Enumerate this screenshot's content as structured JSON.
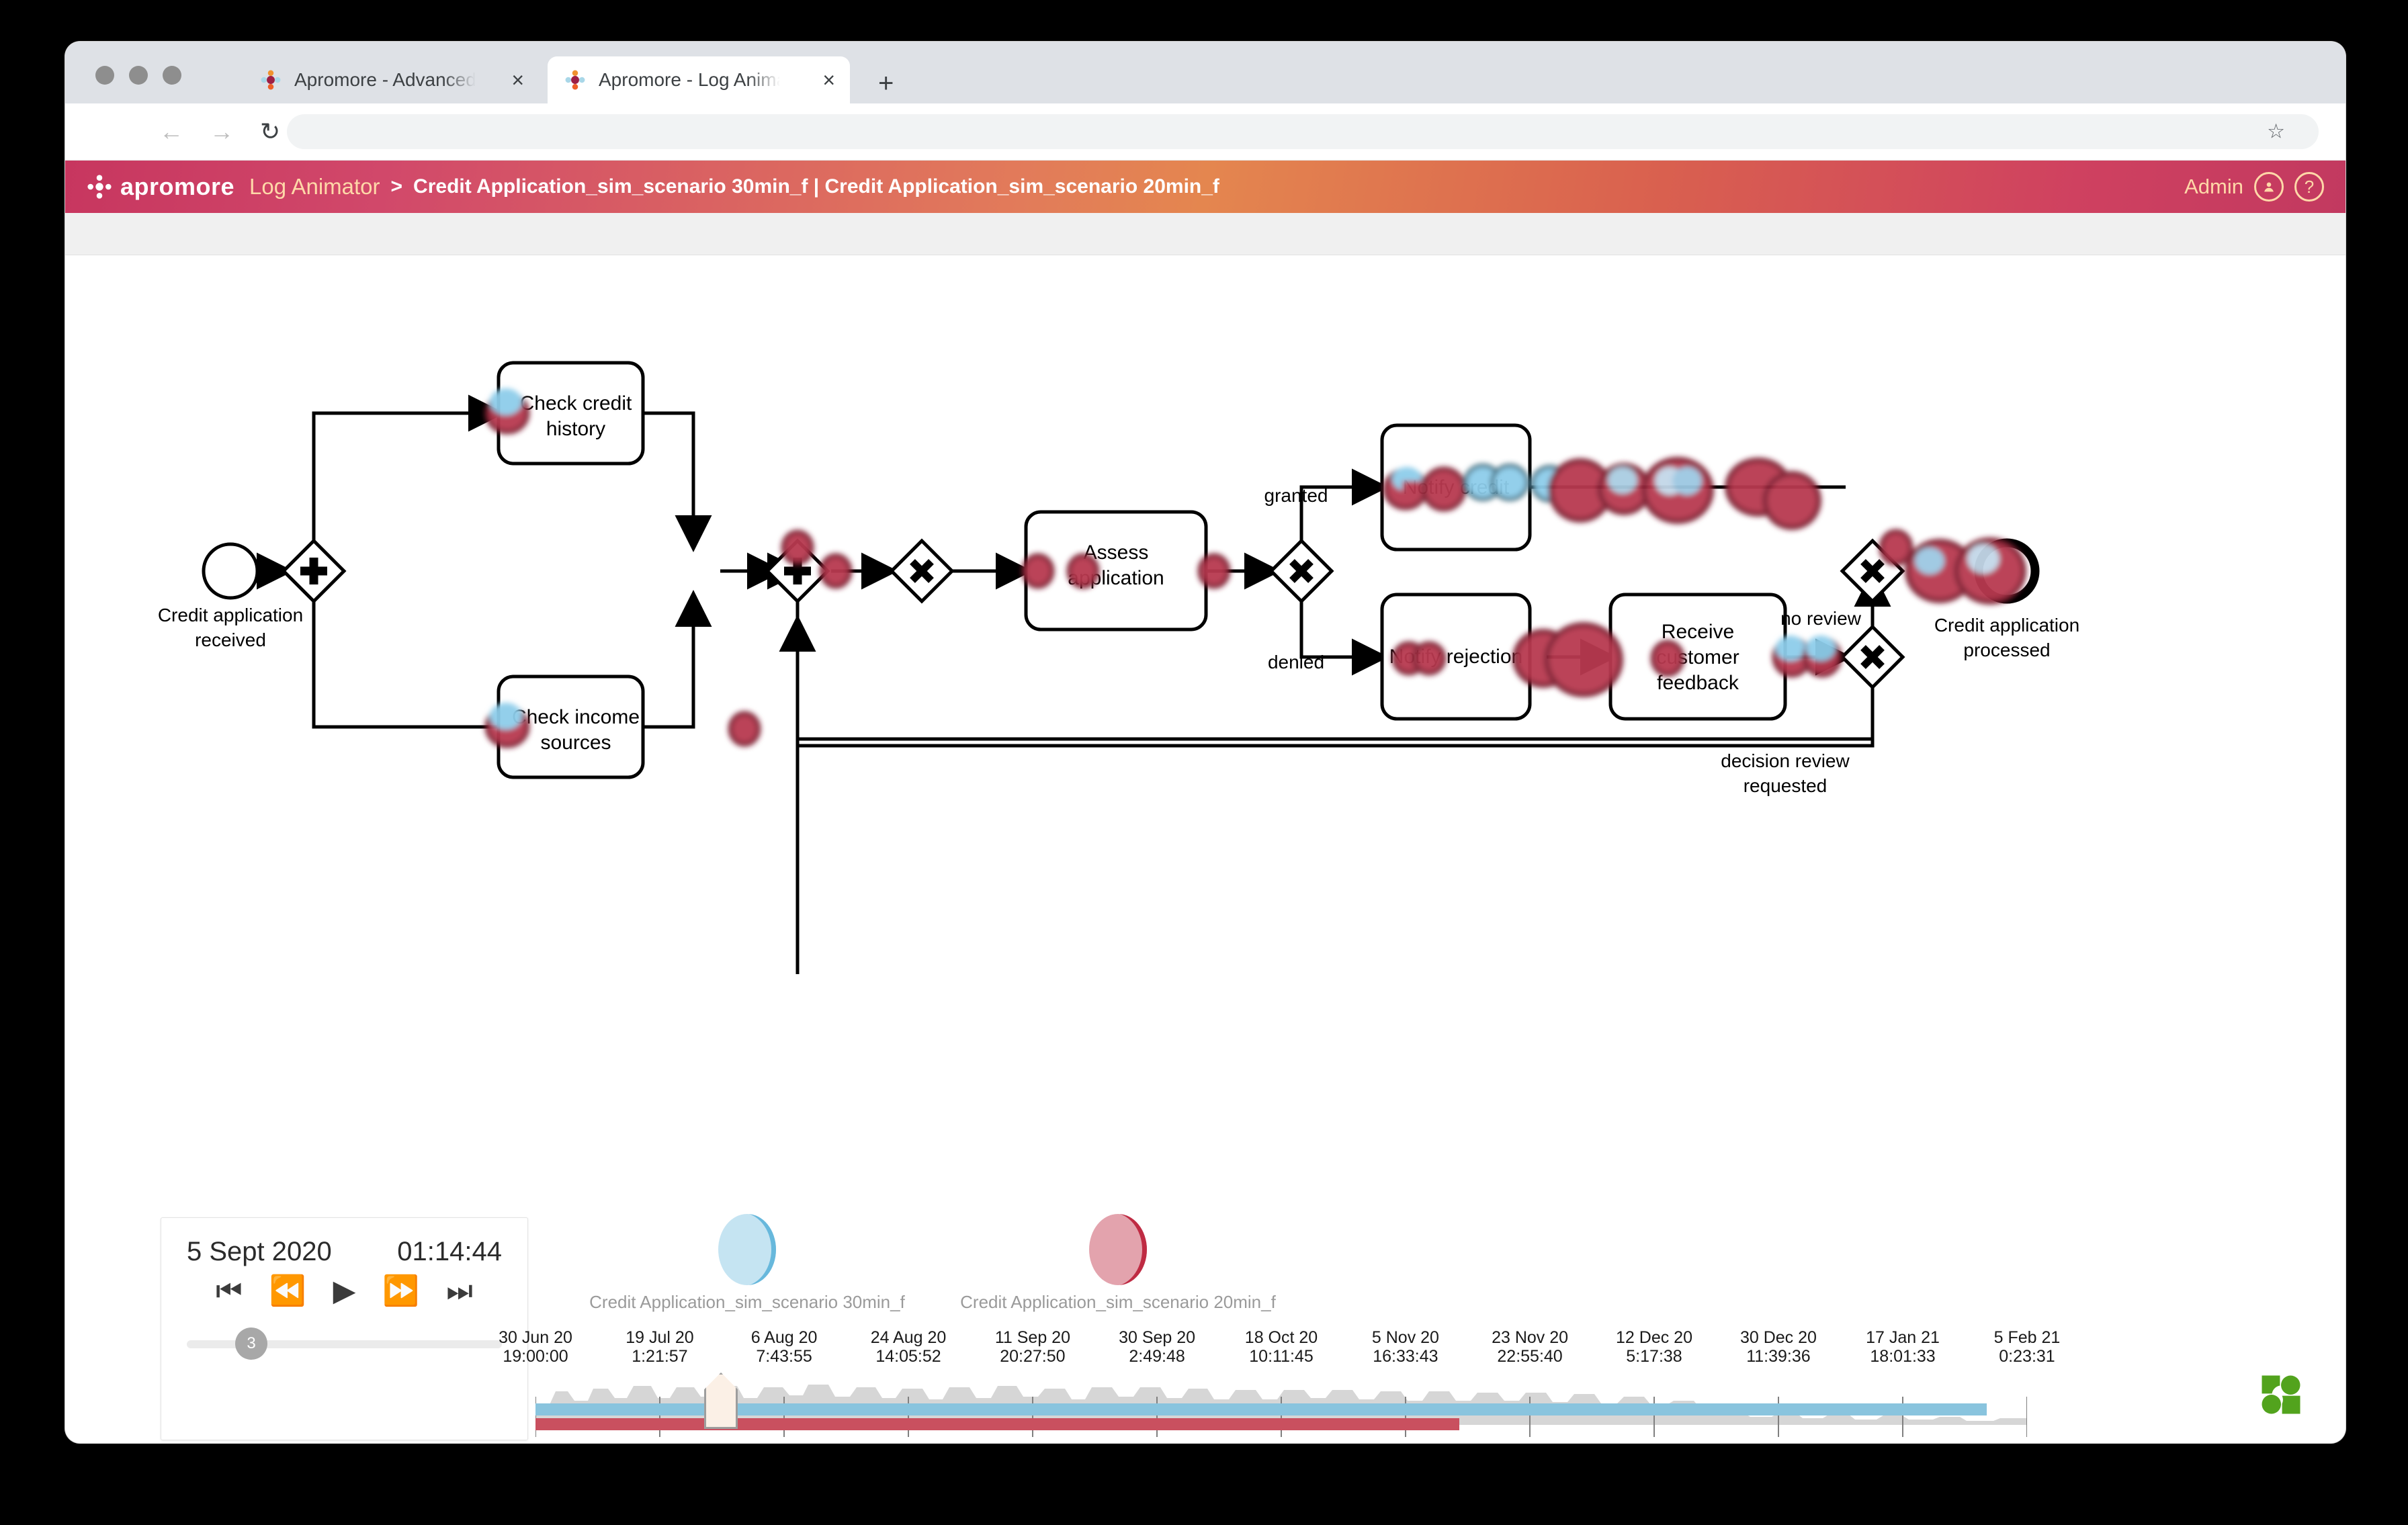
{
  "browser": {
    "tabs": [
      {
        "title": "Apromore - Advanced Process A",
        "favicon": "apromore-favicon",
        "close": "×",
        "active": false
      },
      {
        "title": "Apromore - Log Animator",
        "favicon": "apromore-favicon",
        "close": "×",
        "active": true
      }
    ],
    "new_tab_label": "+",
    "nav": {
      "back": "←",
      "forward": "→",
      "reload": "↻",
      "bookmark": "☆"
    },
    "address_value": "",
    "address_placeholder": ""
  },
  "header": {
    "brand": "apromore",
    "module": "Log Animator",
    "separator": ">",
    "breadcrumb": "Credit Application_sim_scenario 30min_f | Credit Application_sim_scenario 20min_f",
    "user": "Admin",
    "account_icon": "user-icon",
    "help_icon": "question-mark-icon",
    "accent_left": "#c7365f",
    "accent_mid": "#e4864f",
    "accent_right": "#c23960"
  },
  "diagram": {
    "start_event": "Credit application\nreceived",
    "start_event_l1": "Credit application",
    "start_event_l2": "received",
    "end_event_l1": "Credit application",
    "end_event_l2": "processed",
    "tasks": [
      {
        "id": "check-credit-history",
        "l1": "Check credit",
        "l2": "history"
      },
      {
        "id": "check-income-sources",
        "l1": "Check income",
        "l2": "sources"
      },
      {
        "id": "assess-application",
        "l1": "Assess",
        "l2": "application"
      },
      {
        "id": "notify-credit",
        "l1": "Notify credit",
        "l2": ""
      },
      {
        "id": "notify-rejection",
        "l1": "Notify rejection",
        "l2": ""
      },
      {
        "id": "receive-customer-feedback",
        "l1": "Receive",
        "l2": "customer",
        "l3": "feedback"
      }
    ],
    "gateways": [
      {
        "id": "and-split",
        "symbol": "+"
      },
      {
        "id": "and-join",
        "symbol": "+"
      },
      {
        "id": "xor-join-loop",
        "symbol": "✕"
      },
      {
        "id": "xor-split-decision",
        "symbol": "✕"
      },
      {
        "id": "xor-join-review",
        "symbol": "✕"
      },
      {
        "id": "xor-split-review",
        "symbol": "✕"
      }
    ],
    "flow_labels": [
      {
        "id": "granted",
        "text": "granted"
      },
      {
        "id": "denied",
        "text": "denied"
      },
      {
        "id": "no-review",
        "text": "no review"
      },
      {
        "id": "decision-review-requested-l1",
        "text": "decision review"
      },
      {
        "id": "decision-review-requested-l2",
        "text": "requested"
      }
    ],
    "token_colors": {
      "log1": "#8ecdea",
      "log2": "#b83a50",
      "log2_dark": "#7e1f31"
    }
  },
  "controls": {
    "date": "5 Sept 2020",
    "time": "01:14:44",
    "buttons": [
      {
        "id": "skip-to-start-button",
        "glyph": "⏮"
      },
      {
        "id": "rewind-button",
        "glyph": "⏪"
      },
      {
        "id": "play-button",
        "glyph": "▶"
      },
      {
        "id": "fast-forward-button",
        "glyph": "⏩"
      },
      {
        "id": "skip-to-end-button",
        "glyph": "⏭"
      }
    ],
    "speed_value": "3"
  },
  "legend": [
    {
      "id": "log-30min",
      "label": "Credit Application_sim_scenario 30min_f",
      "color": "#c5e4f2",
      "edge": "#67b8dc"
    },
    {
      "id": "log-20min",
      "label": "Credit Application_sim_scenario 20min_f",
      "color": "#e3a3ad",
      "edge": "#bf2b43"
    }
  ],
  "timeline": {
    "ticks": [
      {
        "date": "30 Jun 20",
        "time": "19:00:00",
        "pos": 0
      },
      {
        "date": "19 Jul 20",
        "time": "1:21:57",
        "pos": 8.33
      },
      {
        "date": "6 Aug 20",
        "time": "7:43:55",
        "pos": 16.67
      },
      {
        "date": "24 Aug 20",
        "time": "14:05:52",
        "pos": 25
      },
      {
        "date": "11 Sep 20",
        "time": "20:27:50",
        "pos": 33.33
      },
      {
        "date": "30 Sep 20",
        "time": "2:49:48",
        "pos": 41.67
      },
      {
        "date": "18 Oct 20",
        "time": "10:11:45",
        "pos": 50
      },
      {
        "date": "5 Nov 20",
        "time": "16:33:43",
        "pos": 58.33
      },
      {
        "date": "23 Nov 20",
        "time": "22:55:40",
        "pos": 66.67
      },
      {
        "date": "12 Dec 20",
        "time": "5:17:38",
        "pos": 75
      },
      {
        "date": "30 Dec 20",
        "time": "11:39:36",
        "pos": 83.33
      },
      {
        "date": "17 Jan 21",
        "time": "18:01:33",
        "pos": 91.67
      },
      {
        "date": "5 Feb 21",
        "time": "0:23:31",
        "pos": 100
      }
    ],
    "track_log1_color": "#89c4de",
    "track_log2_color": "#c9505f",
    "playhead_position_pct": 12.3
  },
  "footer": {
    "logo": "bpmn-io-logo",
    "logo_color": "#52a31d"
  }
}
